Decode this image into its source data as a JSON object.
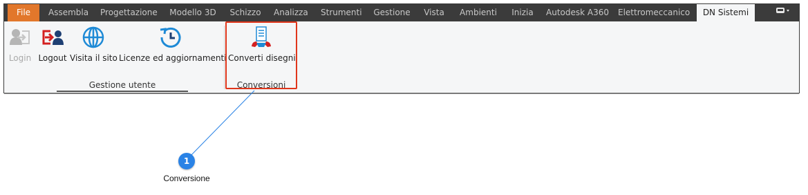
{
  "tabs": [
    {
      "label": "File"
    },
    {
      "label": "Assembla"
    },
    {
      "label": "Progettazione"
    },
    {
      "label": "Modello 3D"
    },
    {
      "label": "Schizzo"
    },
    {
      "label": "Analizza"
    },
    {
      "label": "Strumenti"
    },
    {
      "label": "Gestione"
    },
    {
      "label": "Vista"
    },
    {
      "label": "Ambienti"
    },
    {
      "label": "Inizia"
    },
    {
      "label": "Autodesk A360"
    },
    {
      "label": "Elettromeccanico"
    },
    {
      "label": "DN Sistemi"
    }
  ],
  "active_tab": "DN Sistemi",
  "ribbon": {
    "groups": [
      {
        "label": "Gestione utente",
        "buttons": [
          {
            "label": "Login",
            "icon": "login-icon",
            "enabled": false
          },
          {
            "label": "Logout",
            "icon": "logout-icon",
            "enabled": true
          },
          {
            "label": "Visita il sito",
            "icon": "globe-icon",
            "enabled": true
          },
          {
            "label": "Licenze ed aggiornamenti",
            "icon": "clock-update-icon",
            "enabled": true
          }
        ]
      },
      {
        "label": "Conversioni",
        "buttons": [
          {
            "label": "Converti disegni",
            "icon": "convert-drawings-icon",
            "enabled": true
          }
        ]
      }
    ]
  },
  "callout": {
    "number": "1",
    "text": "Conversione"
  },
  "colors": {
    "file_tab": "#e2772b",
    "tabbar": "#3b3b3b",
    "panel": "#f5f6f7",
    "highlight": "#e0361b",
    "badge": "#2a83e6",
    "logout_red": "#d42020",
    "icon_blue": "#1e8ad6"
  }
}
